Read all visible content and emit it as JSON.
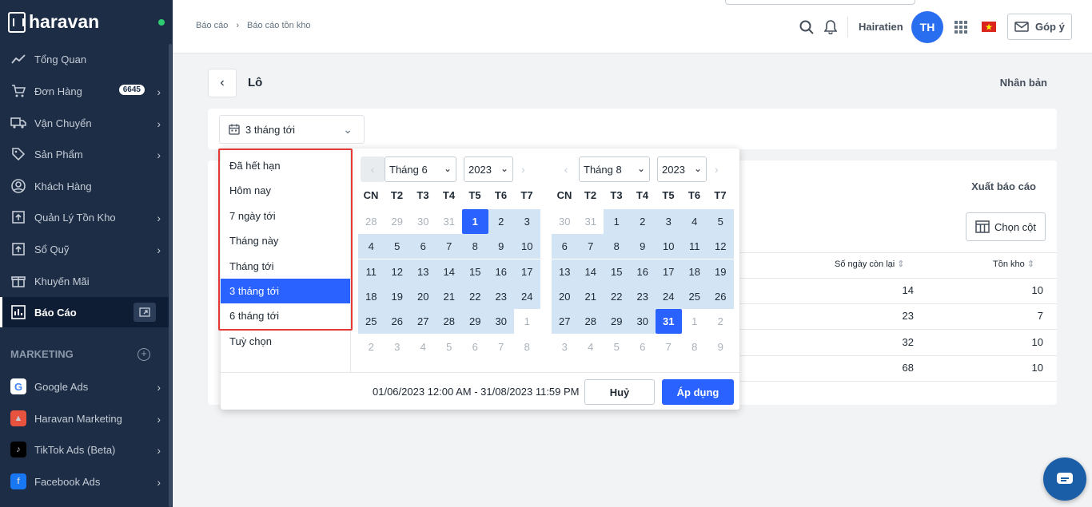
{
  "brand": {
    "name": "haravan"
  },
  "sidebar": {
    "items": [
      {
        "label": "Tổng Quan",
        "icon": "chart-line-icon"
      },
      {
        "label": "Đơn Hàng",
        "icon": "cart-icon",
        "badge": "6645"
      },
      {
        "label": "Vận Chuyển",
        "icon": "truck-icon"
      },
      {
        "label": "Sản Phẩm",
        "icon": "tag-icon"
      },
      {
        "label": "Khách Hàng",
        "icon": "user-icon"
      },
      {
        "label": "Quản Lý Tồn Kho",
        "icon": "inventory-icon"
      },
      {
        "label": "Sổ Quỹ",
        "icon": "cashbook-icon"
      },
      {
        "label": "Khuyến Mãi",
        "icon": "gift-icon"
      },
      {
        "label": "Báo Cáo",
        "icon": "report-icon",
        "active": true
      }
    ],
    "marketing_title": "MARKETING",
    "marketing": [
      {
        "label": "Google Ads",
        "icon": "google-icon",
        "color": "#ffffff"
      },
      {
        "label": "Haravan Marketing",
        "icon": "haravan-marketing-icon",
        "color": "#e8533f"
      },
      {
        "label": "TikTok Ads (Beta)",
        "icon": "tiktok-icon",
        "color": "#000000"
      },
      {
        "label": "Facebook Ads",
        "icon": "facebook-icon",
        "color": "#1877f2"
      }
    ]
  },
  "header": {
    "breadcrumb": [
      "Báo cáo",
      "Báo cáo tồn kho"
    ],
    "breadcrumb_sep": "›",
    "username": "Hairatien",
    "avatar": "TH",
    "feedback": "Góp ý"
  },
  "page": {
    "back": "‹",
    "title": "Lô",
    "duplicate": "Nhân bản",
    "range_label": "3 tháng tới",
    "export": "Xuất báo cáo",
    "choose_columns": "Chọn cột"
  },
  "table": {
    "columns": [
      "Số ngày còn lại",
      "Tồn kho"
    ],
    "rows": [
      {
        "days": "14",
        "stock": "10"
      },
      {
        "days": "23",
        "stock": "7"
      },
      {
        "days": "32",
        "stock": "10"
      },
      {
        "days": "68",
        "stock": "10"
      }
    ]
  },
  "picker": {
    "presets": [
      "Đã hết hạn",
      "Hôm nay",
      "7 ngày tới",
      "Tháng này",
      "Tháng tới",
      "3 tháng tới",
      "6 tháng tới",
      "Tuỳ chọn"
    ],
    "selected_preset": 5,
    "weekdays": [
      "CN",
      "T2",
      "T3",
      "T4",
      "T5",
      "T6",
      "T7"
    ],
    "left": {
      "month": "Tháng 6",
      "year": "2023",
      "days": [
        [
          "28",
          "29",
          "30",
          "31",
          "1",
          "2",
          "3"
        ],
        [
          "4",
          "5",
          "6",
          "7",
          "8",
          "9",
          "10"
        ],
        [
          "11",
          "12",
          "13",
          "14",
          "15",
          "16",
          "17"
        ],
        [
          "18",
          "19",
          "20",
          "21",
          "22",
          "23",
          "24"
        ],
        [
          "25",
          "26",
          "27",
          "28",
          "29",
          "30",
          "1"
        ],
        [
          "2",
          "3",
          "4",
          "5",
          "6",
          "7",
          "8"
        ]
      ],
      "states": [
        [
          "out",
          "out",
          "out",
          "out",
          "edge",
          "in",
          "in"
        ],
        [
          "in",
          "in",
          "in",
          "in",
          "in",
          "in",
          "in"
        ],
        [
          "in",
          "in",
          "in",
          "in",
          "in",
          "in",
          "in"
        ],
        [
          "in",
          "in",
          "in",
          "in",
          "in",
          "in",
          "in"
        ],
        [
          "in",
          "in",
          "in",
          "in",
          "in",
          "in",
          "out"
        ],
        [
          "out",
          "out",
          "out",
          "out",
          "out",
          "out",
          "out"
        ]
      ]
    },
    "right": {
      "month": "Tháng 8",
      "year": "2023",
      "days": [
        [
          "30",
          "31",
          "1",
          "2",
          "3",
          "4",
          "5"
        ],
        [
          "6",
          "7",
          "8",
          "9",
          "10",
          "11",
          "12"
        ],
        [
          "13",
          "14",
          "15",
          "16",
          "17",
          "18",
          "19"
        ],
        [
          "20",
          "21",
          "22",
          "23",
          "24",
          "25",
          "26"
        ],
        [
          "27",
          "28",
          "29",
          "30",
          "31",
          "1",
          "2"
        ],
        [
          "3",
          "4",
          "5",
          "6",
          "7",
          "8",
          "9"
        ]
      ],
      "states": [
        [
          "out",
          "out",
          "in",
          "in",
          "in",
          "in",
          "in"
        ],
        [
          "in",
          "in",
          "in",
          "in",
          "in",
          "in",
          "in"
        ],
        [
          "in",
          "in",
          "in",
          "in",
          "in",
          "in",
          "in"
        ],
        [
          "in",
          "in",
          "in",
          "in",
          "in",
          "in",
          "in"
        ],
        [
          "in",
          "in",
          "in",
          "in",
          "edge",
          "out",
          "out"
        ],
        [
          "out",
          "out",
          "out",
          "out",
          "out",
          "out",
          "out"
        ]
      ]
    },
    "range_text": "01/06/2023 12:00 AM - 31/08/2023 11:59 PM",
    "cancel": "Huỷ",
    "apply": "Áp dụng"
  }
}
